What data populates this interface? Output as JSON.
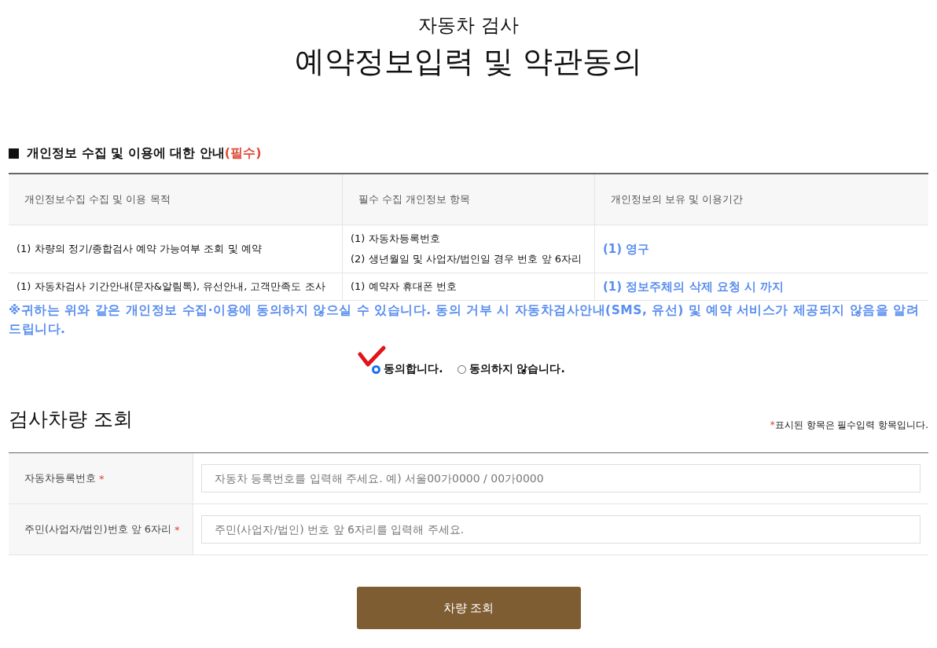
{
  "header": {
    "subtitle": "자동차 검사",
    "title": "예약정보입력 및 약관동의"
  },
  "privacy": {
    "heading": "개인정보 수집 및 이용에 대한 안내",
    "heading_tag": "(필수)",
    "table": {
      "columns": [
        "개인정보수집 수집 및 이용 목적",
        "필수 수집 개인정보 항목",
        "개인정보의 보유 및 이용기간"
      ],
      "rows": [
        {
          "purpose": "(1) 차량의 정기/종합검사 예약 가능여부 조회 및 예약",
          "items": [
            "(1) 자동차등록번호",
            "(2) 생년월일 및 사업자/법인일 경우 번호 앞 6자리"
          ],
          "period": "(1) 영구"
        },
        {
          "purpose": "(1) 자동차검사 기간안내(문자&알림톡), 유선안내, 고객만족도 조사",
          "items": [
            "(1) 예약자 휴대폰 번호"
          ],
          "period": "(1) 정보주체의 삭제 요청 시 까지"
        }
      ]
    },
    "notice": "※귀하는 위와 같은 개인정보 수집·이용에 동의하지 않으실 수 있습니다. 동의 거부 시 자동차검사안내(SMS, 유선) 및 예약 서비스가 제공되지 않음을 알려드립니다.",
    "consent": [
      {
        "label": "동의합니다.",
        "selected": true
      },
      {
        "label": "동의하지 않습니다.",
        "selected": false
      }
    ]
  },
  "lookup": {
    "title": "검사차량 조회",
    "note_mark": "*",
    "note": "표시된 항목은 필수입력 항목입니다.",
    "fields": [
      {
        "label": "자동차등록번호",
        "required_mark": "*",
        "placeholder": "자동차 등록번호를 입력해 주세요. 예) 서울00가0000 / 00가0000"
      },
      {
        "label": "주민(사업자/법인)번호 앞 6자리",
        "required_mark": "*",
        "placeholder": "주민(사업자/법인) 번호 앞 6자리를 입력해 주세요."
      }
    ],
    "button": "차량 조회"
  }
}
